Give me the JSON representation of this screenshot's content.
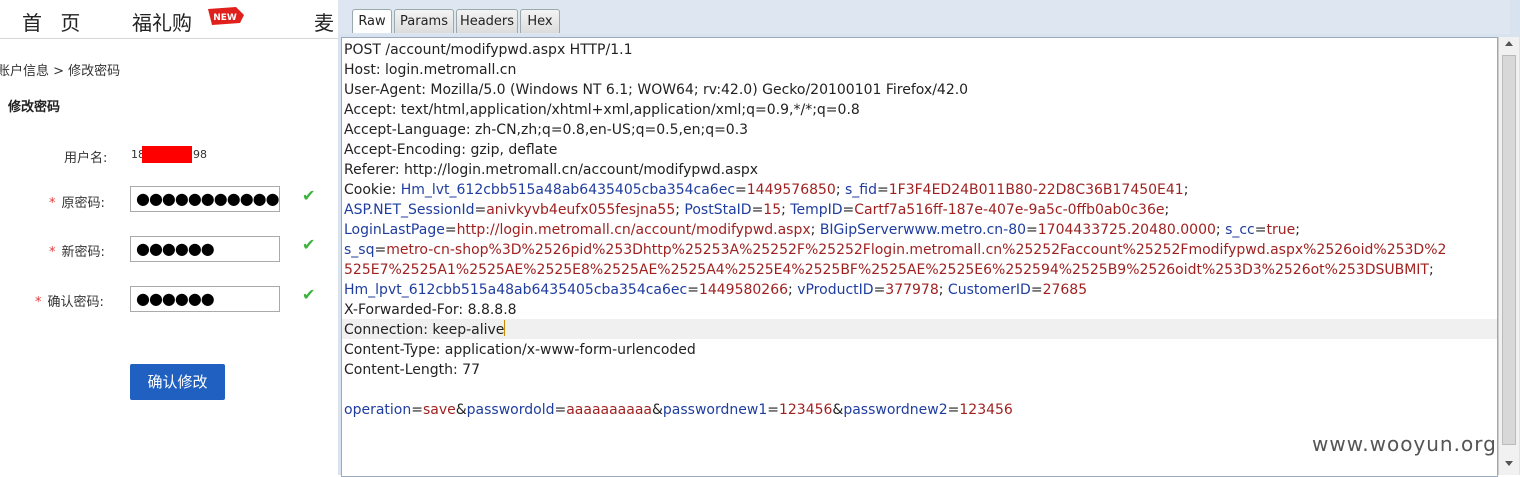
{
  "web": {
    "nav": {
      "home": "首 页",
      "gift": "福礼购",
      "new_badge": "NEW",
      "more": "麦"
    },
    "breadcrumb": "账户信息 > 修改密码",
    "title": "修改密码",
    "form": {
      "username_label": "用户名:",
      "username_prefix": "18",
      "username_suffix": "98",
      "required_mark": "*",
      "old_pwd_label": "原密码:",
      "old_pwd_value": "●●●●●●●●●●●",
      "new_pwd_label": "新密码:",
      "new_pwd_value": "●●●●●●",
      "confirm_pwd_label": "确认密码:",
      "confirm_pwd_value": "●●●●●●",
      "check_mark": "✔",
      "submit_label": "确认修改"
    }
  },
  "viewer": {
    "tabs": [
      "Raw",
      "Params",
      "Headers",
      "Hex"
    ],
    "active_tab": "Raw",
    "request": {
      "request_line": "POST /account/modifypwd.aspx HTTP/1.1",
      "host": "Host: login.metromall.cn",
      "user_agent": "User-Agent: Mozilla/5.0 (Windows NT 6.1; WOW64; rv:42.0) Gecko/20100101 Firefox/42.0",
      "accept": "Accept: text/html,application/xhtml+xml,application/xml;q=0.9,*/*;q=0.8",
      "accept_language": "Accept-Language: zh-CN,zh;q=0.8,en-US;q=0.5,en;q=0.3",
      "accept_encoding": "Accept-Encoding: gzip, deflate",
      "referer": "Referer: http://login.metromall.cn/account/modifypwd.aspx",
      "cookie_label": "Cookie: ",
      "cookies": {
        "c1_name": "Hm_lvt_612cbb515a48ab6435405cba354ca6ec",
        "c1_value": "1449576850",
        "c2_name": "s_fid",
        "c2_value": "1F3F4ED24B011B80-22D8C36B17450E41",
        "c3_name": "ASP.NET_SessionId",
        "c3_value": "anivkyvb4eufx055fesjna55",
        "c4_name": "PostStaID",
        "c4_value": "15",
        "c5_name": "TempID",
        "c5_value": "Cartf7a516ff-187e-407e-9a5c-0ffb0ab0c36e",
        "c6_name": "LoginLastPage",
        "c6_value": "http://login.metromall.cn/account/modifypwd.aspx",
        "c7_name": "BIGipServerwww.metro.cn-80",
        "c7_value": "1704433725.20480.0000",
        "c8_name": "s_cc",
        "c8_value": "true",
        "c9_name": "s_sq",
        "c9_value_part1": "metro-cn-shop%3D%2526pid%253Dhttp%25253A%25252F%25252Flogin.metromall.cn%25252Faccount%25252Fmodifypwd.aspx%2526oid%253D%2",
        "c9_value_part2": "525E7%2525A1%2525AE%2525E8%2525AE%2525A4%2525E4%2525BF%2525AE%2525E6%252594%2525B9%2526oidt%253D3%2526ot%253DSUBMIT",
        "c10_name": "Hm_lpvt_612cbb515a48ab6435405cba354ca6ec",
        "c10_value": "1449580266",
        "c11_name": "vProductID",
        "c11_value": "377978",
        "c12_name": "CustomerID",
        "c12_value": "27685"
      },
      "x_forwarded_for": "X-Forwarded-For: 8.8.8.8",
      "connection": "Connection: keep-alive",
      "content_type": "Content-Type: application/x-www-form-urlencoded",
      "content_length": "Content-Length: 77",
      "body": {
        "p1_name": "operation",
        "p1_value": "save",
        "p2_name": "passwordold",
        "p2_value": "aaaaaaaaaa",
        "p3_name": "passwordnew1",
        "p3_value": "123456",
        "p4_name": "passwordnew2",
        "p4_value": "123456"
      }
    }
  },
  "watermark": "www.wooyun.org"
}
